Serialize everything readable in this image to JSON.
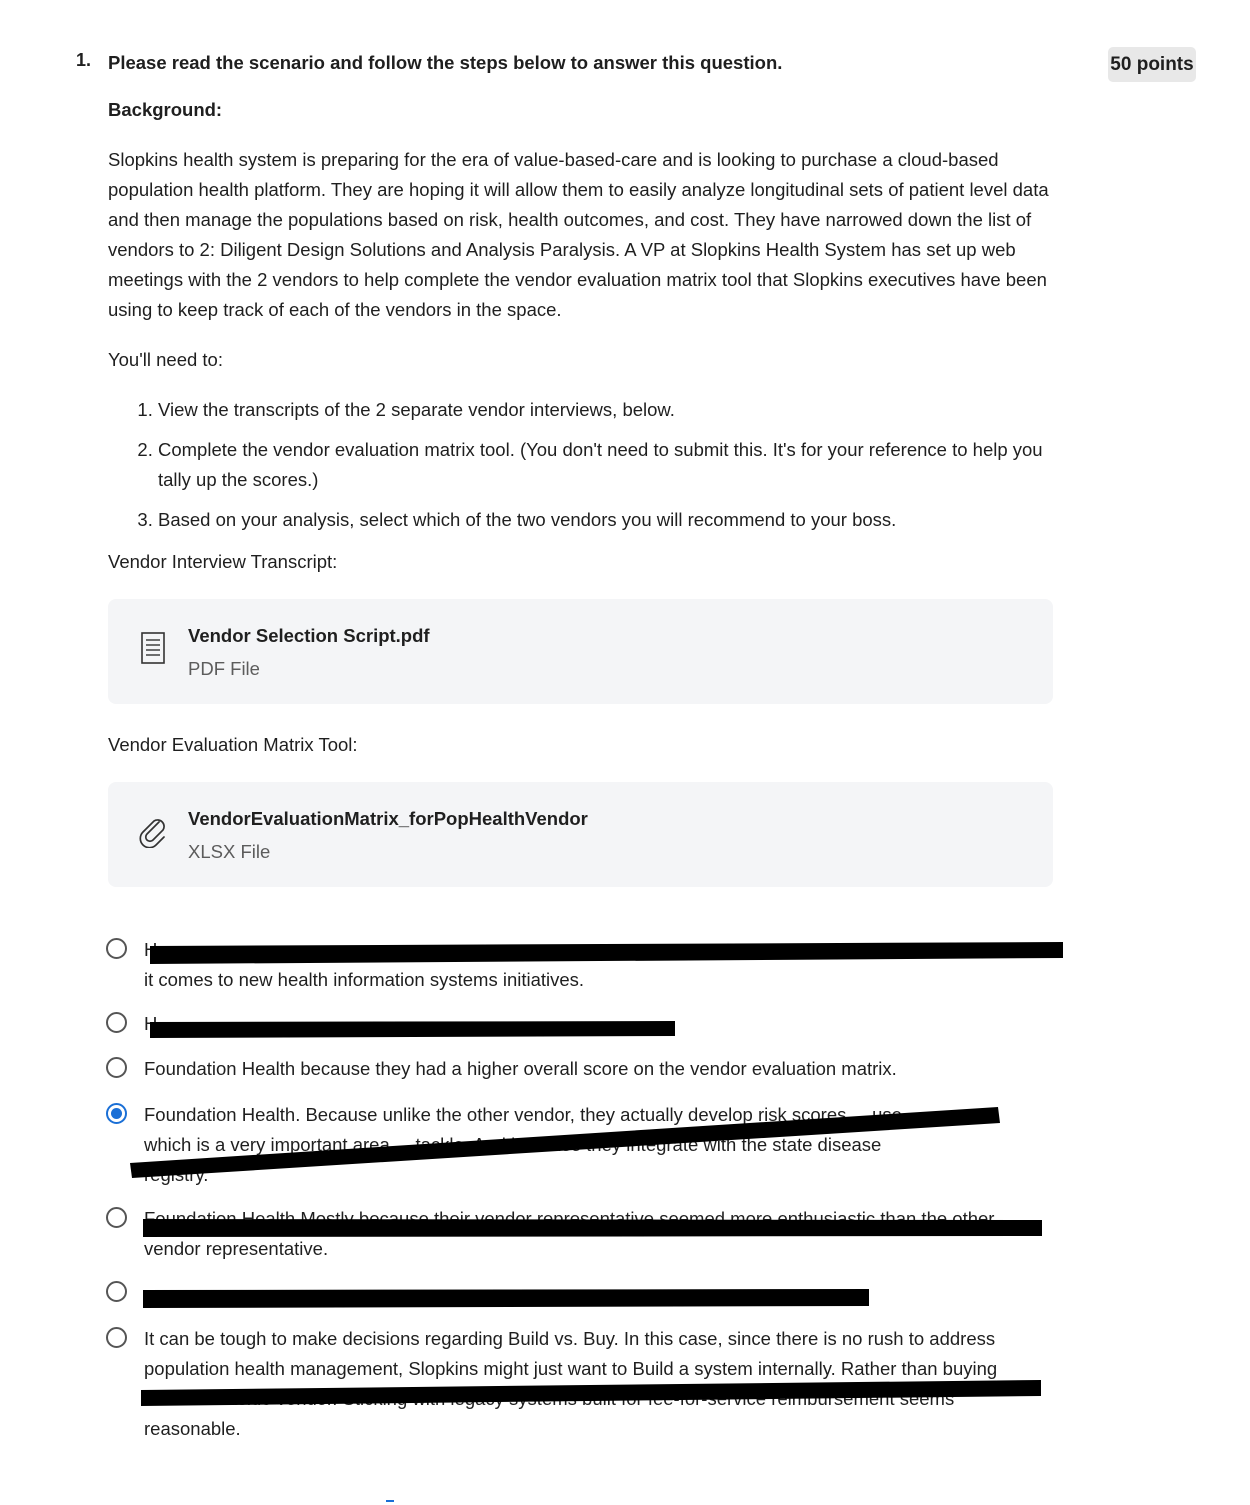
{
  "question": {
    "number": "1.",
    "title": "Please read the scenario and follow the steps below to answer this question.",
    "points": "50 points"
  },
  "scenario": {
    "background_label": "Background:",
    "paragraph": "Slopkins health system is preparing for the era of value-based-care and is looking to purchase a cloud-based population health platform. They are hoping it will allow them to easily analyze longitudinal sets of patient level data and then manage the populations based on risk, health outcomes, and cost. They have narrowed down the list of vendors to 2: Diligent Design Solutions and Analysis Paralysis. A VP at Slopkins Health System has set up web meetings with the 2 vendors to help complete the vendor evaluation matrix tool that Slopkins executives have been using to keep track of each of the vendors in the space.",
    "need_to": "You'll need to:",
    "steps": [
      "View the transcripts of the 2 separate vendor interviews, below.",
      "Complete the vendor evaluation matrix tool. (You don't need to submit this. It's for your reference to help you tally up the scores.)",
      "Based on your analysis, select which of the two vendors you will recommend to your boss."
    ]
  },
  "attachments": [
    {
      "section_label": "Vendor Interview Transcript:",
      "name": "Vendor Selection Script.pdf",
      "type": "PDF File",
      "icon": "document-icon"
    },
    {
      "section_label": "Vendor Evaluation Matrix Tool:",
      "name": "VendorEvaluationMatrix_forPopHealthVendor",
      "type": "XLSX File",
      "icon": "paperclip-icon"
    }
  ],
  "options": [
    {
      "lines": [
        "H",
        "it comes to new health information systems initiatives."
      ],
      "selected": false
    },
    {
      "lines": [
        "H"
      ],
      "selected": false
    },
    {
      "lines": [
        "Foundation Health because they had a higher overall score on the vendor evaluation matrix."
      ],
      "selected": false
    },
    {
      "lines": [
        "Foundation Health. Because unlike the other vendor, they actually develop risk scores ... use",
        "which is a very important area ... tackle. And because they integrate with the state disease",
        "registry."
      ],
      "selected": true
    },
    {
      "lines": [
        "Foundation Health Mostly because their vendor representative seemed more enthusiastic than the other",
        "vendor representative."
      ],
      "selected": false
    },
    {
      "lines": [
        ""
      ],
      "selected": false
    },
    {
      "lines": [
        "It can be tough to make decisions regarding Build vs. Buy. In this case, since there is no rush to address",
        "population health management, Slopkins might just want to Build a system internally. Rather than buying",
        "from an outside vendor. Sticking with legacy systems built for fee-for-service reimbursement seems",
        "reasonable."
      ],
      "selected": false
    }
  ]
}
